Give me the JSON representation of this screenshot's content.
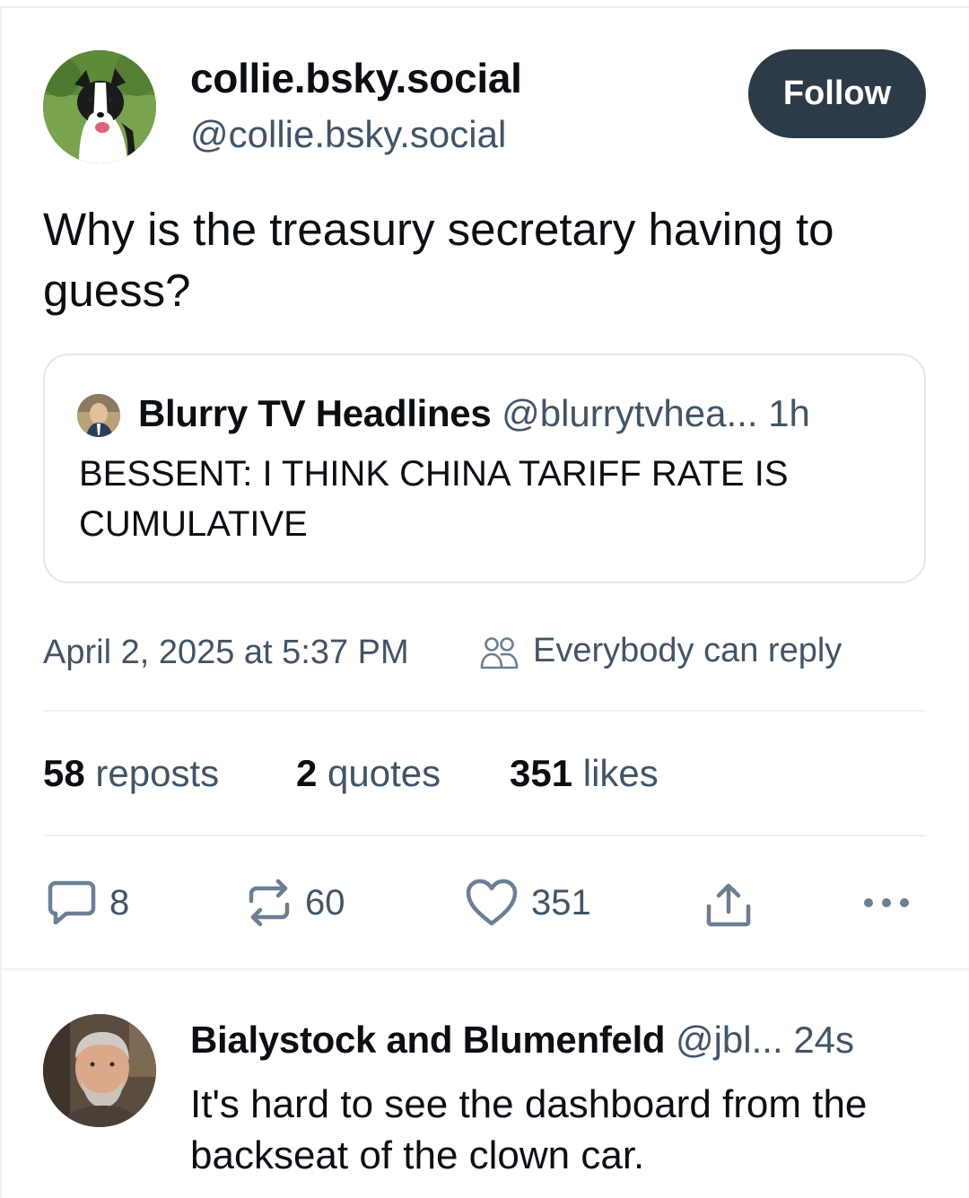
{
  "post": {
    "author_name": "collie.bsky.social",
    "author_handle": "@collie.bsky.social",
    "follow_label": "Follow",
    "text": "Why is the treasury secretary having to guess?",
    "timestamp": "April 2, 2025 at 5:37 PM",
    "reply_setting": "Everybody can reply"
  },
  "quote": {
    "author_name": "Blurry TV Headlines",
    "author_handle": "@blurrytvhea...",
    "time": "1h",
    "text": "BESSENT: I THINK CHINA TARIFF RATE IS CUMULATIVE"
  },
  "stats": {
    "reposts_count": "58",
    "reposts_label": "reposts",
    "quotes_count": "2",
    "quotes_label": "quotes",
    "likes_count": "351",
    "likes_label": "likes"
  },
  "actions": {
    "reply_count": "8",
    "repost_count": "60",
    "like_count": "351"
  },
  "reply": {
    "author_name": "Bialystock and Blumenfeld",
    "author_handle": "@jbl...",
    "time": "24s",
    "text": "It's hard to see the dashboard from the backseat of the clown car."
  },
  "icons": {
    "reply": "comment-icon",
    "repost": "repost-icon",
    "like": "heart-icon",
    "share": "share-icon",
    "more": "more-icon",
    "audience": "people-icon"
  },
  "colors": {
    "follow_button": "#2d3a48",
    "muted_text": "#425466",
    "icon": "#6b7f94"
  }
}
